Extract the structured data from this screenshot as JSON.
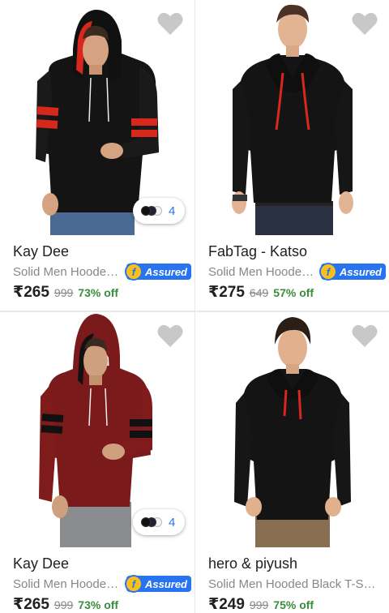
{
  "products": [
    {
      "brand": "Kay Dee",
      "title": "Solid Men Hooded Red, Black T-Shirt",
      "assured_label": "Assured",
      "assured_icon": "f",
      "price": "₹265",
      "mrp": "999",
      "discount": "73% off",
      "swatch_count": "4",
      "image": "man-black-hoodie-red-stripes"
    },
    {
      "brand": "FabTag - Katso",
      "title": "Solid Men Hooded Black T-Shirt",
      "assured_label": "Assured",
      "assured_icon": "f",
      "price": "₹275",
      "mrp": "649",
      "discount": "57% off",
      "image": "man-black-hoodie-red-drawstrings"
    },
    {
      "brand": "Kay Dee",
      "title": "Solid Men Hooded Maroon T-Shirt",
      "assured_label": "Assured",
      "assured_icon": "f",
      "price": "₹265",
      "mrp": "999",
      "discount": "73% off",
      "swatch_count": "4",
      "image": "man-maroon-hoodie-black-stripes"
    },
    {
      "brand": "hero & piyush",
      "title": "Solid Men Hooded Black T-Shirt",
      "price": "₹249",
      "mrp": "999",
      "discount": "75% off",
      "image": "man-black-hoodie-red-drawstrings"
    }
  ],
  "colors": {
    "assured_blue": "#2874f0",
    "discount_green": "#388e3c",
    "heart_grey": "#c8c8c8",
    "title_grey": "#878787"
  }
}
